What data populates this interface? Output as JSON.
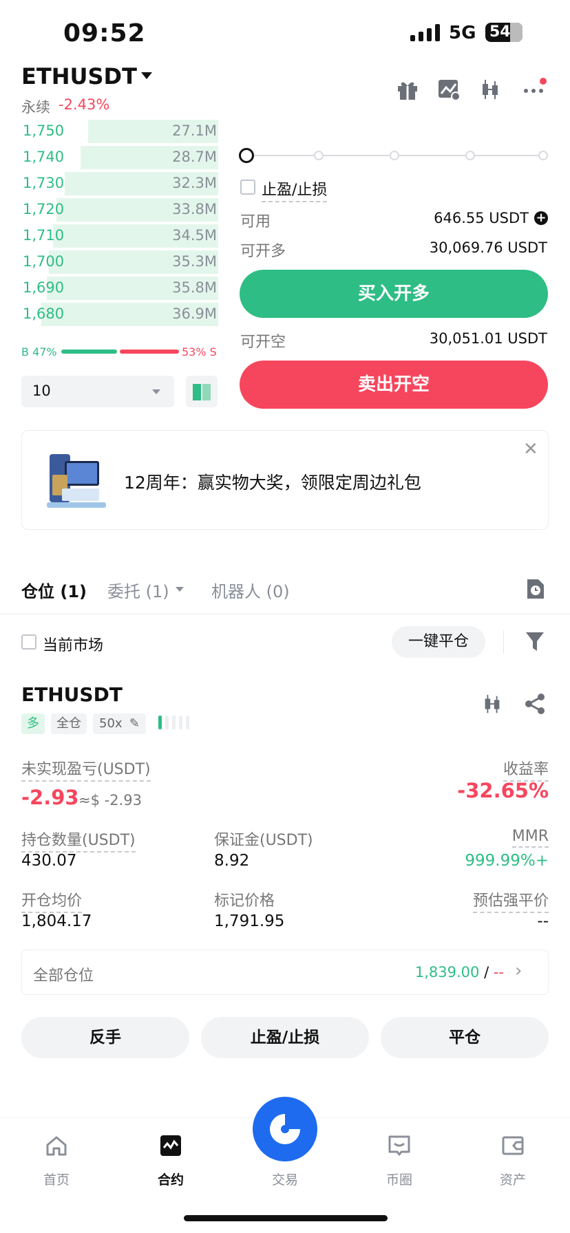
{
  "status_bar": {
    "time": "09:52",
    "network": "5G",
    "battery": "54"
  },
  "header": {
    "symbol": "ETHUSDT",
    "contract_type": "永续",
    "change": "-2.43%"
  },
  "header_icons": [
    "gift-icon",
    "chart-alert-icon",
    "candlestick-icon",
    "more-icon"
  ],
  "order_book": {
    "rows": [
      {
        "price": "1,750",
        "qty": "27.1M",
        "depth": 0.66
      },
      {
        "price": "1,740",
        "qty": "28.7M",
        "depth": 0.7
      },
      {
        "price": "1,730",
        "qty": "32.3M",
        "depth": 0.78
      },
      {
        "price": "1,720",
        "qty": "33.8M",
        "depth": 0.82
      },
      {
        "price": "1,710",
        "qty": "34.5M",
        "depth": 0.84
      },
      {
        "price": "1,700",
        "qty": "35.3M",
        "depth": 0.86
      },
      {
        "price": "1,690",
        "qty": "35.8M",
        "depth": 0.87
      },
      {
        "price": "1,680",
        "qty": "36.9M",
        "depth": 0.9
      }
    ],
    "buy_ratio": "B 47%",
    "sell_ratio": "53% S",
    "depth_select": "10"
  },
  "order_form": {
    "tp_sl_label": "止盈/止损",
    "available_label": "可用",
    "available_value": "646.55 USDT",
    "can_long_label": "可开多",
    "can_long_value": "30,069.76 USDT",
    "buy_button": "买入开多",
    "can_short_label": "可开空",
    "can_short_value": "30,051.01 USDT",
    "sell_button": "卖出开空"
  },
  "banner": {
    "text": "12周年：赢实物大奖，领限定周边礼包",
    "close": "✕"
  },
  "tabs": {
    "positions": "仓位 (1)",
    "orders": "委托 (1)",
    "bots": "机器人 (0)"
  },
  "filters": {
    "current_market": "当前市场",
    "close_all": "一键平仓"
  },
  "position": {
    "symbol": "ETHUSDT",
    "side": "多",
    "margin_mode": "全仓",
    "leverage": "50x",
    "unrealized_pnl_label": "未实现盈亏(USDT)",
    "unrealized_pnl": "-2.93",
    "unrealized_pnl_usd": "≈$ -2.93",
    "roe_label": "收益率",
    "roe": "-32.65%",
    "size_label": "持仓数量(USDT)",
    "size": "430.07",
    "margin_label": "保证金(USDT)",
    "margin": "8.92",
    "mmr_label": "MMR",
    "mmr": "999.99%+",
    "entry_label": "开仓均价",
    "entry": "1,804.17",
    "mark_label": "标记价格",
    "mark": "1,791.95",
    "liq_label": "预估强平价",
    "liq": "--",
    "all_positions_label": "全部仓位",
    "all_positions_value": "1,839.00",
    "all_positions_sep": "/",
    "all_positions_suffix": "--",
    "reverse_button": "反手",
    "tp_sl_button": "止盈/止损",
    "close_button": "平仓"
  },
  "nav": {
    "home": "首页",
    "futures": "合约",
    "trade": "交易",
    "feed": "币圈",
    "assets": "资产"
  },
  "colors": {
    "buy": "#2ebd85",
    "sell": "#f6465d",
    "brand": "#1f6bf0"
  }
}
